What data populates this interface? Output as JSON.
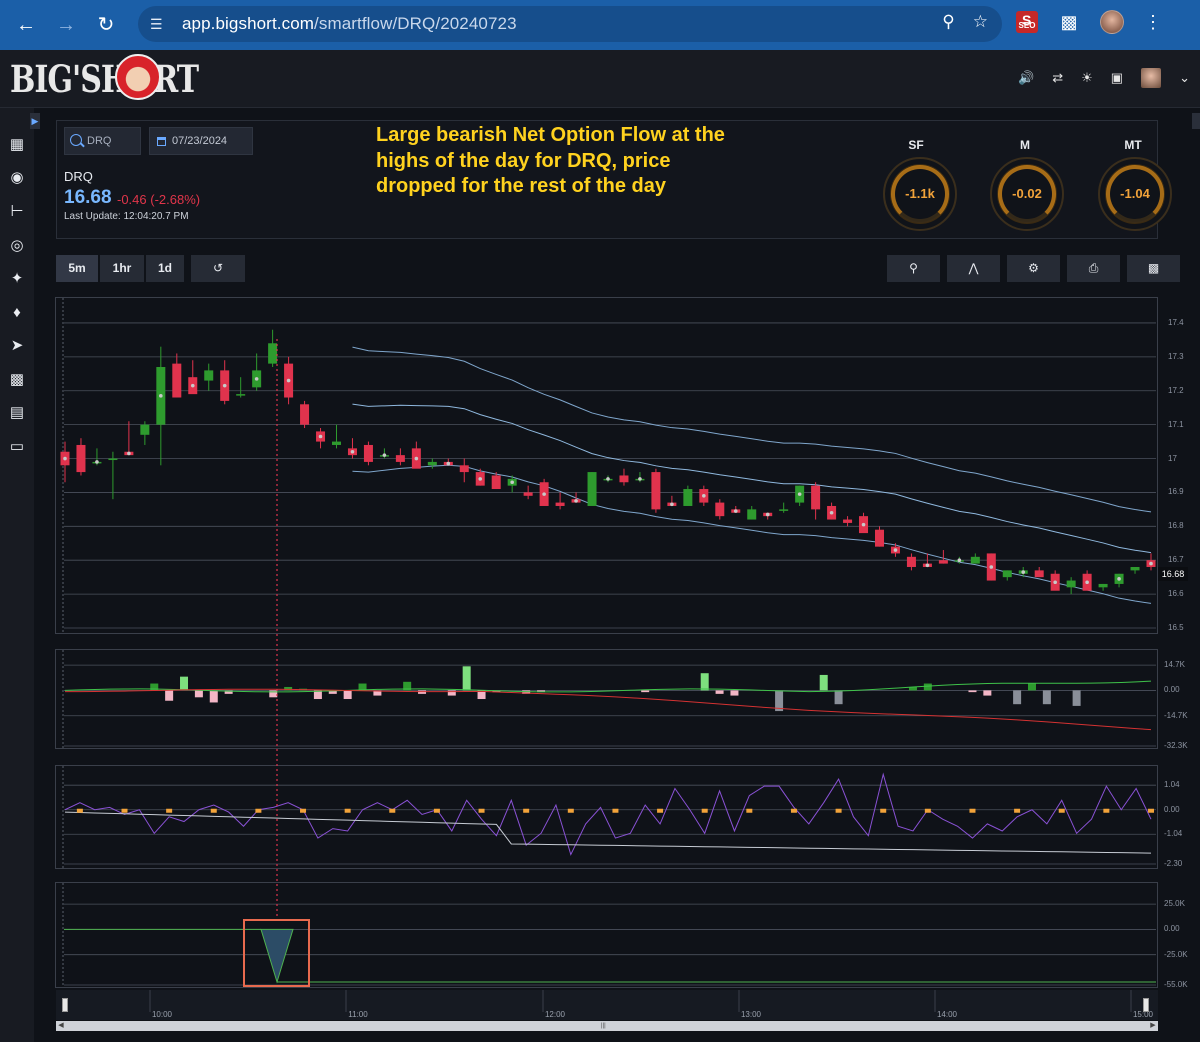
{
  "browser": {
    "url_host": "app.bigshort.com",
    "url_path": "/smartflow/DRQ/20240723",
    "extension_label": "SEO"
  },
  "app": {
    "logo": "BIG'SHORT",
    "symbol_placeholder": "DRQ",
    "date": "07/23/2024",
    "ticker": "DRQ",
    "price": "16.68",
    "change": "-0.46 (-2.68%)",
    "last_update": "Last Update: 12:04:20.7 PM",
    "annotation": "Large bearish Net Option Flow at the highs of the day for DRQ, price dropped for the rest of the day",
    "gauges": [
      {
        "label": "SF",
        "value": "-1.1k"
      },
      {
        "label": "M",
        "value": "-0.02"
      },
      {
        "label": "MT",
        "value": "-1.04"
      }
    ],
    "timeframes": [
      "5m",
      "1hr",
      "1d"
    ],
    "active_timeframe": "5m",
    "icons": {
      "history": "history-icon",
      "zoom": "zoom-icon",
      "indicators": "line-chart-icon",
      "settings": "gear-icon",
      "print": "print-icon",
      "bars": "bar-chart-icon"
    },
    "colors": {
      "up": "#2e9b2e",
      "down": "#e0334d",
      "annotation": "#ffd21f",
      "gauge": "#f2a33a",
      "price_text": "#79b8ff",
      "highlight": "#e86a4e"
    }
  },
  "chart_data": [
    {
      "type": "candlestick",
      "panel": "price",
      "y_ticks": [
        "17.4",
        "17.3",
        "17.2",
        "17.1",
        "17",
        "16.9",
        "16.8",
        "16.7",
        "16.6",
        "16.5"
      ],
      "ylim": [
        16.5,
        17.45
      ],
      "x_ticks": [
        "10:00",
        "11:00",
        "12:00",
        "13:00",
        "14:00",
        "15:00"
      ],
      "last_price_label": "16.68",
      "candles_ohlc": [
        [
          17.02,
          17.05,
          16.93,
          16.98
        ],
        [
          17.04,
          17.06,
          16.95,
          16.96
        ],
        [
          16.99,
          17.03,
          16.98,
          16.99
        ],
        [
          17.0,
          17.02,
          16.88,
          17.0
        ],
        [
          17.02,
          17.11,
          17.01,
          17.01
        ],
        [
          17.07,
          17.11,
          17.04,
          17.1
        ],
        [
          17.1,
          17.33,
          16.98,
          17.27
        ],
        [
          17.28,
          17.31,
          17.18,
          17.18
        ],
        [
          17.24,
          17.29,
          17.2,
          17.19
        ],
        [
          17.23,
          17.28,
          17.2,
          17.26
        ],
        [
          17.26,
          17.29,
          17.16,
          17.17
        ],
        [
          17.19,
          17.24,
          17.18,
          17.19
        ],
        [
          17.21,
          17.31,
          17.2,
          17.26
        ],
        [
          17.28,
          17.38,
          17.27,
          17.34
        ],
        [
          17.28,
          17.3,
          17.16,
          17.18
        ],
        [
          17.16,
          17.17,
          17.09,
          17.1
        ],
        [
          17.08,
          17.09,
          17.03,
          17.05
        ],
        [
          17.04,
          17.1,
          17.03,
          17.05
        ],
        [
          17.03,
          17.06,
          17.0,
          17.01
        ],
        [
          17.04,
          17.05,
          16.98,
          16.99
        ],
        [
          17.01,
          17.03,
          17.0,
          17.01
        ],
        [
          17.01,
          17.03,
          16.98,
          16.99
        ],
        [
          17.03,
          17.05,
          16.98,
          16.97
        ],
        [
          16.98,
          17.0,
          16.97,
          16.99
        ],
        [
          16.99,
          17.0,
          16.98,
          16.98
        ],
        [
          16.98,
          17.0,
          16.93,
          16.96
        ],
        [
          16.96,
          16.97,
          16.92,
          16.92
        ],
        [
          16.95,
          16.96,
          16.91,
          16.91
        ],
        [
          16.92,
          16.95,
          16.9,
          16.94
        ],
        [
          16.9,
          16.92,
          16.88,
          16.89
        ],
        [
          16.93,
          16.94,
          16.86,
          16.86
        ],
        [
          16.87,
          16.9,
          16.85,
          16.86
        ],
        [
          16.88,
          16.9,
          16.87,
          16.87
        ],
        [
          16.86,
          16.96,
          16.86,
          16.96
        ],
        [
          16.94,
          16.95,
          16.93,
          16.94
        ],
        [
          16.95,
          16.97,
          16.92,
          16.93
        ],
        [
          16.94,
          16.96,
          16.93,
          16.94
        ],
        [
          16.96,
          16.97,
          16.84,
          16.85
        ],
        [
          16.87,
          16.89,
          16.86,
          16.86
        ],
        [
          16.86,
          16.92,
          16.86,
          16.91
        ],
        [
          16.91,
          16.92,
          16.86,
          16.87
        ],
        [
          16.87,
          16.88,
          16.82,
          16.83
        ],
        [
          16.85,
          16.86,
          16.84,
          16.84
        ],
        [
          16.82,
          16.86,
          16.82,
          16.85
        ],
        [
          16.84,
          16.84,
          16.82,
          16.83
        ],
        [
          16.85,
          16.87,
          16.84,
          16.85
        ],
        [
          16.87,
          16.92,
          16.86,
          16.92
        ],
        [
          16.92,
          16.93,
          16.82,
          16.85
        ],
        [
          16.86,
          16.87,
          16.82,
          16.82
        ],
        [
          16.82,
          16.83,
          16.8,
          16.81
        ],
        [
          16.83,
          16.84,
          16.8,
          16.78
        ],
        [
          16.79,
          16.8,
          16.74,
          16.74
        ],
        [
          16.74,
          16.75,
          16.71,
          16.72
        ],
        [
          16.71,
          16.72,
          16.67,
          16.68
        ],
        [
          16.69,
          16.72,
          16.68,
          16.68
        ],
        [
          16.7,
          16.73,
          16.69,
          16.69
        ],
        [
          16.7,
          16.71,
          16.69,
          16.7
        ],
        [
          16.69,
          16.72,
          16.69,
          16.71
        ],
        [
          16.72,
          16.72,
          16.64,
          16.64
        ],
        [
          16.65,
          16.67,
          16.64,
          16.67
        ],
        [
          16.66,
          16.68,
          16.65,
          16.67
        ],
        [
          16.67,
          16.68,
          16.66,
          16.65
        ],
        [
          16.66,
          16.67,
          16.62,
          16.61
        ],
        [
          16.62,
          16.65,
          16.6,
          16.64
        ],
        [
          16.66,
          16.67,
          16.62,
          16.61
        ],
        [
          16.62,
          16.63,
          16.61,
          16.63
        ],
        [
          16.63,
          16.66,
          16.62,
          16.66
        ],
        [
          16.67,
          16.68,
          16.66,
          16.68
        ],
        [
          16.7,
          16.72,
          16.67,
          16.68
        ]
      ]
    },
    {
      "type": "bar",
      "panel": "net-flow",
      "y_ticks": [
        "14.7K",
        "0.00",
        "-14.7K",
        "-32.3K"
      ],
      "ylim": [
        -32.3,
        20
      ],
      "values": [
        0,
        0,
        0,
        0,
        0,
        0,
        4,
        -6,
        8,
        -4,
        -7,
        -2,
        0,
        0,
        -4,
        2,
        1,
        -5,
        -2,
        -5,
        4,
        -3,
        0,
        5,
        -2,
        0,
        -3,
        14,
        -5,
        -1,
        0,
        -2,
        -1,
        0,
        0,
        0,
        0,
        0,
        0,
        -1,
        0,
        0,
        0,
        10,
        -2,
        -3,
        0,
        0,
        -12,
        0,
        0,
        9,
        -8,
        0,
        0,
        0,
        0,
        2,
        4,
        0,
        0,
        -1,
        -3,
        0,
        -8,
        4,
        -8,
        0,
        -9,
        0,
        0,
        0,
        0,
        0
      ]
    },
    {
      "type": "line",
      "panel": "oscillator",
      "y_ticks": [
        "1.04",
        "0.00",
        "-1.04",
        "-2.30"
      ],
      "ylim": [
        -2.3,
        1.6
      ]
    },
    {
      "type": "area",
      "panel": "cumulative",
      "y_ticks": [
        "25.0K",
        "0.00",
        "-25.0K",
        "-55.0K"
      ],
      "ylim": [
        -55.0,
        40.0
      ]
    }
  ]
}
